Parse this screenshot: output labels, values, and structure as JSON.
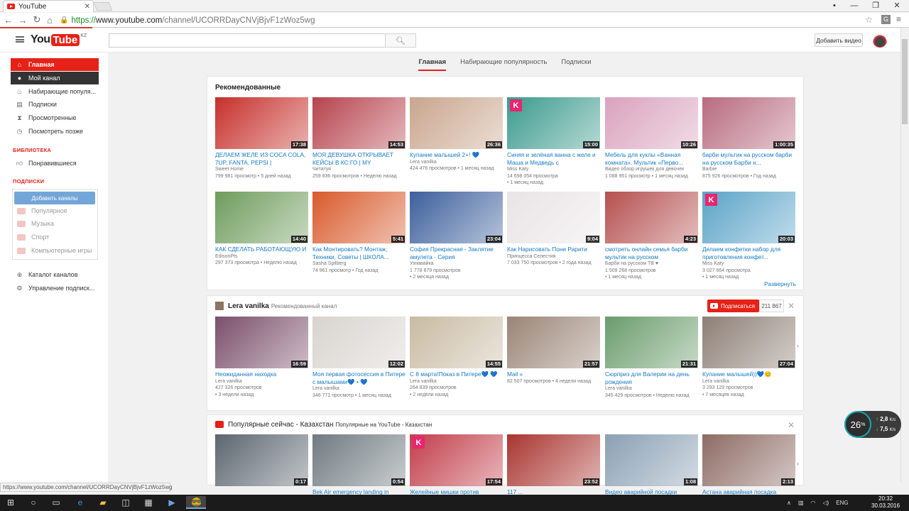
{
  "browser": {
    "tab_title": "YouTube",
    "url_scheme": "https://",
    "url_host": "www.youtube.com",
    "url_path": "/channel/UCORRDayCNVjBjvF1zWoz5wg",
    "status_url": "https://www.youtube.com/channel/UCORRDayCNVjBjvF1zWoz5wg"
  },
  "masthead": {
    "logo_you": "You",
    "logo_tube": "Tube",
    "logo_region": "KZ",
    "search_placeholder": "",
    "upload_label": "Добавить видео"
  },
  "sidebar": {
    "items": [
      {
        "label": "Главная",
        "icon": "home-icon"
      },
      {
        "label": "Мой канал",
        "icon": "user-icon"
      },
      {
        "label": "Набирающие популя...",
        "icon": "flame-icon"
      },
      {
        "label": "Подписки",
        "icon": "subscriptions-icon"
      },
      {
        "label": "Просмотренные",
        "icon": "hourglass-icon"
      },
      {
        "label": "Посмотреть позже",
        "icon": "clock-icon"
      }
    ],
    "library_heading": "БИБЛИОТЕКА",
    "library_items": [
      {
        "label": "Понравившиеся",
        "icon": "thumbs-up-icon"
      }
    ],
    "subs_heading": "ПОДПИСКИ",
    "add_channels": "Добавить каналы",
    "sub_items": [
      "Популярное",
      "Музыка",
      "Спорт",
      "Компьютерные игры"
    ],
    "bottom_items": [
      {
        "label": "Каталог каналов",
        "icon": "plus-circle-icon"
      },
      {
        "label": "Управление подписк...",
        "icon": "gear-icon"
      }
    ]
  },
  "tabs": [
    {
      "label": "Главная",
      "active": true
    },
    {
      "label": "Набирающие популярность",
      "active": false
    },
    {
      "label": "Подписки",
      "active": false
    }
  ],
  "recommended": {
    "title": "Рекомендованные",
    "expand": "Развернуть",
    "videos": [
      {
        "title": "ДЕЛАЕМ ЖЕЛЕ ИЗ COCA COLA, 7UP, FANTA, PEPSI |",
        "channel": "Sweet Home",
        "meta": "799 981 просмотр • 5 дней назад",
        "meta2": "",
        "duration": "17:38",
        "color": "#c62f2a",
        "k": false
      },
      {
        "title": "МОЯ ДЕВУШКА ОТКРЫВАЕТ КЕЙСЫ В КС:ГО | MY",
        "channel": "Читатуя",
        "meta": "259 836 просмотров • Неделю назад",
        "meta2": "",
        "duration": "14:53",
        "color": "#b6434d",
        "k": false
      },
      {
        "title": "Купание малышей 2+! 💙",
        "channel": "Lera vanilka",
        "meta": "424 476 просмотров • 1 месяц назад",
        "meta2": "",
        "duration": "26:36",
        "color": "#c9a58d",
        "k": false
      },
      {
        "title": "Синяя и зелёная ванна с желе и Маша и Медведь с",
        "channel": "Miss Katy",
        "meta": "14 698 054 просмотра",
        "meta2": "• 1 месяц назад",
        "duration": "15:00",
        "color": "#3b9a8e",
        "k": true
      },
      {
        "title": "Мебель для куклы «Ванная комната». Мультик «Перво...",
        "channel": "Видео обзор игрушек для девочек",
        "meta": "1 088 951 просмотр • 1 месяц назад",
        "meta2": "",
        "duration": "10:26",
        "color": "#d9a2bd",
        "k": false
      },
      {
        "title": "барби мультик на русском барби на русском Барби н...",
        "channel": "Barbie",
        "meta": "875 926 просмотров • Год назад",
        "meta2": "",
        "duration": "1:00:35",
        "color": "#b86b80",
        "k": false
      },
      {
        "title": "КАК СДЕЛАТЬ РАБОТАЮЩУЮ И",
        "channel": "EdisonPts",
        "meta": "297 373 просмотра • Неделю назад",
        "meta2": "",
        "duration": "14:40",
        "color": "#6e9c5c",
        "k": false
      },
      {
        "title": "Как Монтировать? Монтаж, Техники, Советы | ШКОЛА...",
        "channel": "Sasha Spilberg",
        "meta": "74 961 просмотр • Год назад",
        "meta2": "",
        "duration": "5:41",
        "color": "#d85a2c",
        "k": false
      },
      {
        "title": "София Прекрасная - Заклятие амулета - Серия",
        "channel": "Узнавайка",
        "meta": "1 778 879 просмотров",
        "meta2": "• 2 месяца назад",
        "duration": "23:04",
        "color": "#3c5f9c",
        "k": false
      },
      {
        "title": "Как Нарисовать Пони Рарити",
        "channel": "Принцесса Селестия",
        "meta": "7 033 750 просмотров • 2 года назад",
        "meta2": "",
        "duration": "9:04",
        "color": "#e9e4e6",
        "k": false
      },
      {
        "title": "смотреть онлайн семья барби мультик на русском",
        "channel": "Барби на русском ТВ ♥",
        "meta": "1 509 268 просмотров",
        "meta2": "• 1 месяц назад",
        "duration": "4:23",
        "color": "#b5504f",
        "k": false
      },
      {
        "title": "Делаем конфетки набор для приготовления конфет...",
        "channel": "Miss Katy",
        "meta": "3 027 664 просмотра",
        "meta2": "• 1 месяц назад",
        "duration": "20:03",
        "color": "#5aa3c8",
        "k": true
      }
    ]
  },
  "channel_shelf": {
    "name": "Lera vanilka",
    "tag": "Рекомендованный канал",
    "subscribe": "Подписаться",
    "count": "211 867",
    "videos": [
      {
        "title": "Неожиданная находка",
        "channel": "Lera vanilka",
        "meta": "427 326 просмотров",
        "meta2": "• 3 недели назад",
        "duration": "16:59",
        "color": "#7a4f6b"
      },
      {
        "title": "Моя первая фотосессия в Питере с малышами💙 • 💙",
        "channel": "Lera vanilka",
        "meta": "346 771 просмотр • 1 месяц назад",
        "meta2": "",
        "duration": "12:02",
        "color": "#d8d3ce"
      },
      {
        "title": "С 8 марта!Показ в Питере💙 💙",
        "channel": "Lera vanilka",
        "meta": "264 839 просмотров",
        "meta2": "• 2 недели назад",
        "duration": "14:55",
        "color": "#c9bba3"
      },
      {
        "title": "Mail »",
        "channel": "",
        "meta": "82 507 просмотров • 4 недели назад",
        "meta2": "",
        "duration": "21:57",
        "color": "#9a8576"
      },
      {
        "title": "Сюрприз для Валерии на день рождения",
        "channel": "Lera vanilka",
        "meta": "345 429 просмотров • Неделю назад",
        "meta2": "",
        "duration": "21:31",
        "color": "#6a9c6b"
      },
      {
        "title": "Купание малышей))💙😊",
        "channel": "Lera vanilka",
        "meta": "3 293 129 просмотров",
        "meta2": "• 7 месяцев назад",
        "duration": "27:04",
        "color": "#8d7f75"
      }
    ]
  },
  "popular": {
    "title": "Популярные сейчас - Казахстан",
    "tag": "Популярные на YouTube - Казахстан",
    "videos": [
      {
        "title": "",
        "duration": "0:17",
        "color": "#5c6670"
      },
      {
        "title": "Bek Air emergency landing in",
        "duration": "0:54",
        "color": "#6f7a80"
      },
      {
        "title": "Желейные мишки против",
        "duration": "17:54",
        "color": "#c13e4a",
        "k": true
      },
      {
        "title": "117 ...",
        "duration": "23:52",
        "color": "#a93530"
      },
      {
        "title": "Видео аварийной посадки",
        "duration": "1:08",
        "color": "#8aa0b4"
      },
      {
        "title": "Астана аварийная посадка",
        "duration": "2:13",
        "color": "#8d6b64"
      }
    ]
  },
  "speed_widget": {
    "percent": "26",
    "unit": "%",
    "up": "2,8",
    "down": "7,5",
    "rate_unit": "K/s"
  },
  "taskbar": {
    "lang": "ENG",
    "time": "20:32",
    "date": "30.03.2016"
  },
  "colors": {
    "brand": "#e62117",
    "link": "#167ac6"
  }
}
